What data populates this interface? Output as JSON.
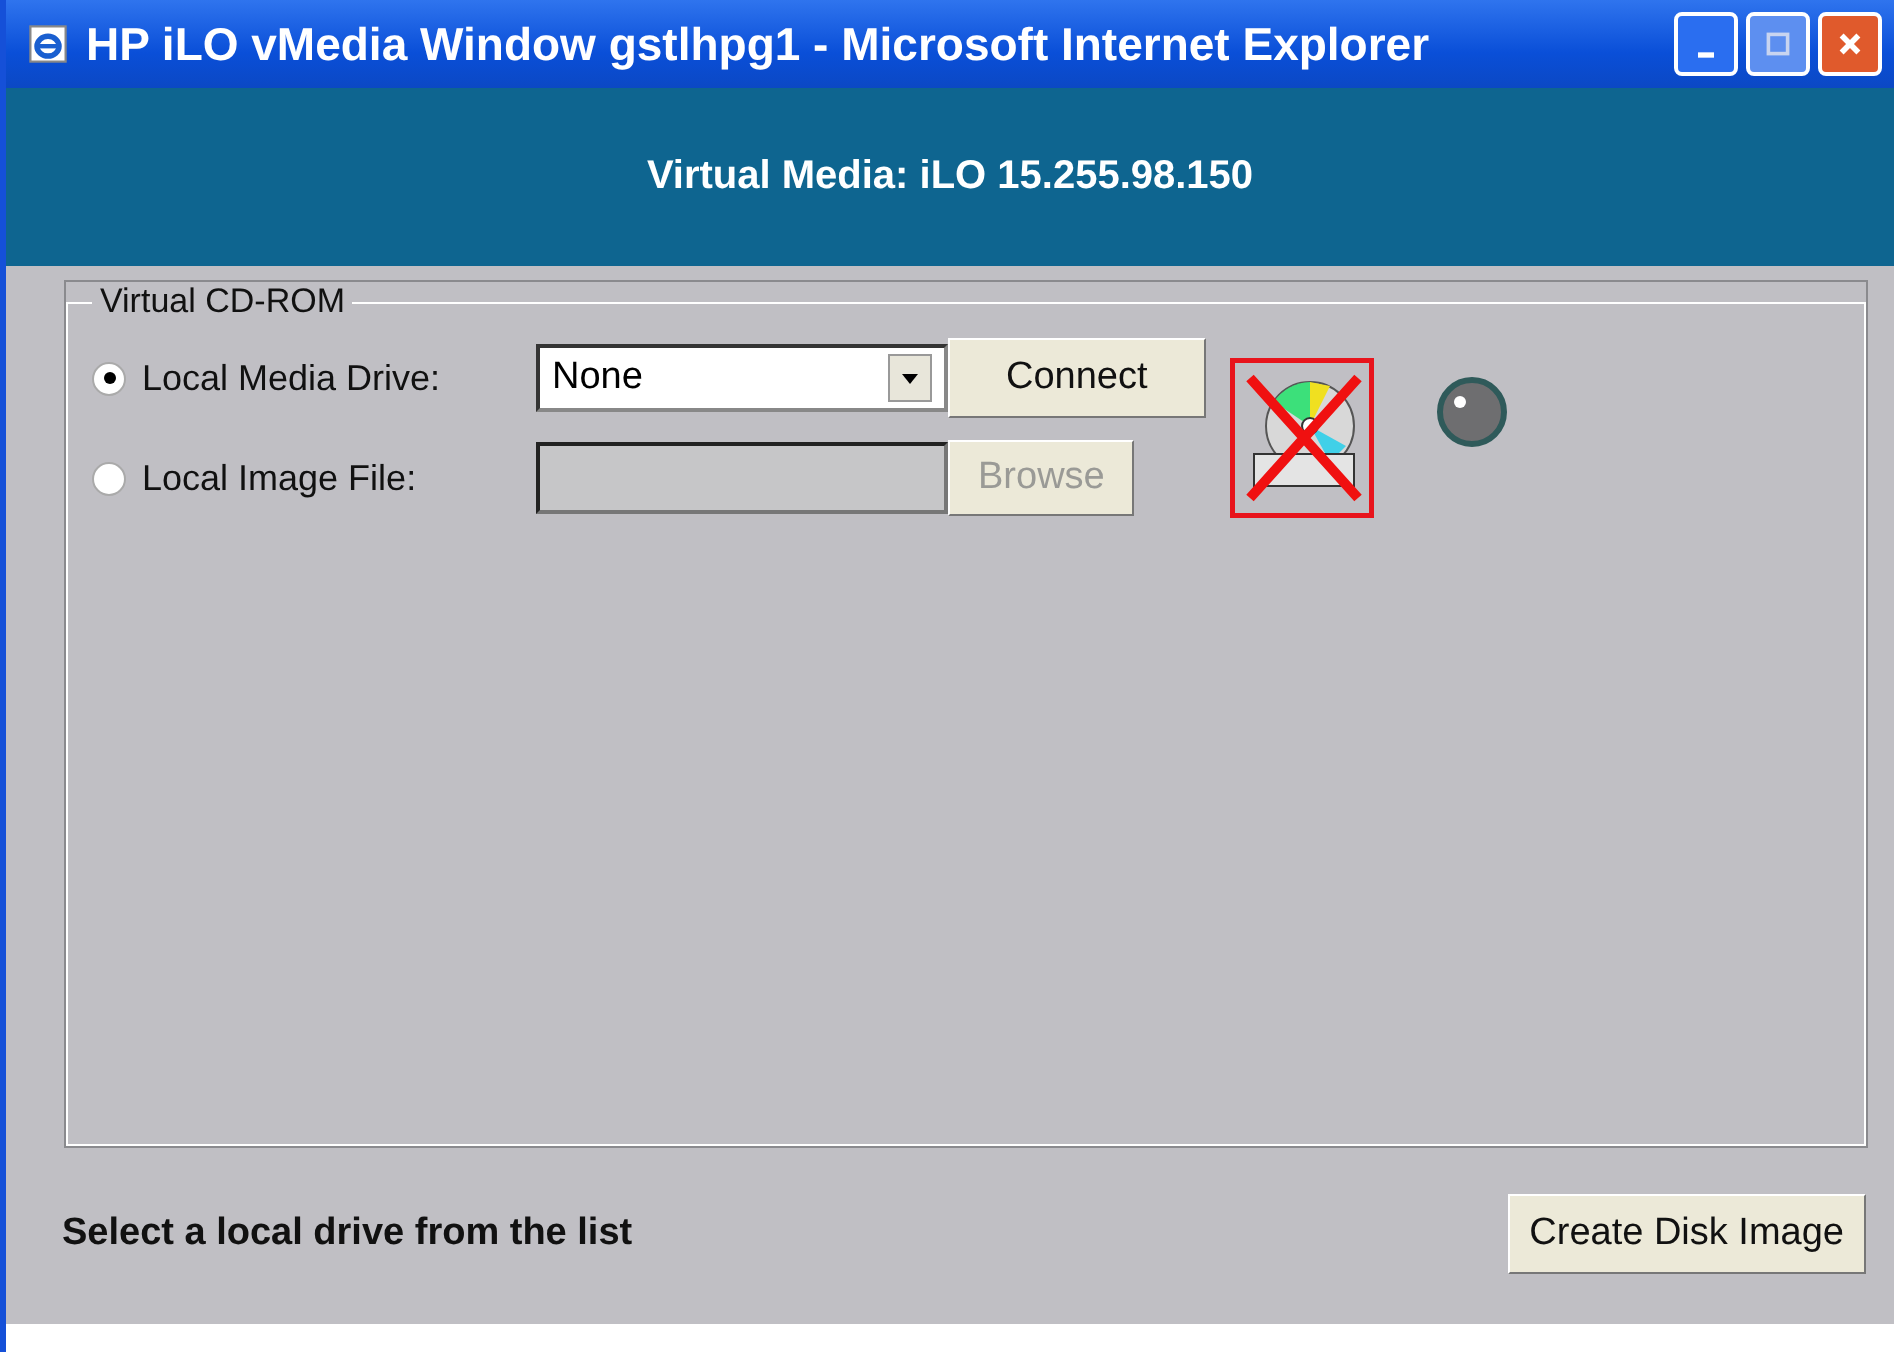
{
  "window": {
    "title": "HP iLO vMedia Window gstlhpg1 - Microsoft Internet Explorer"
  },
  "header": {
    "title": "Virtual Media: iLO 15.255.98.150"
  },
  "group": {
    "label": "Virtual CD-ROM",
    "connected": false,
    "options": [
      {
        "kind": "dropdown",
        "label": "Local Media Drive:",
        "selected": true,
        "value": "None",
        "button": {
          "label": "Connect",
          "disabled": false
        }
      },
      {
        "kind": "file",
        "label": "Local Image File:",
        "selected": false,
        "disabled": true,
        "button": {
          "label": "Browse",
          "disabled": true
        }
      }
    ]
  },
  "status_text": "Select a local drive from the list",
  "buttons": [
    "Create Disk Image"
  ]
}
